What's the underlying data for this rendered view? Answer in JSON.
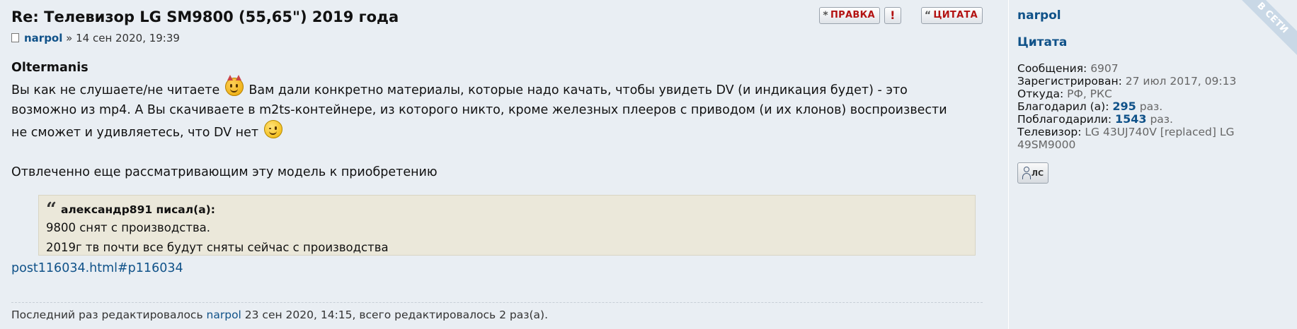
{
  "post": {
    "title": "Re: Телевизор LG SM9800 (55,65\") 2019 года",
    "author": "narpol",
    "separator": " » ",
    "date": "14 сен 2020, 19:39",
    "buttons": {
      "edit_label": "ПРАВКА",
      "report_label": "!",
      "quote_label": "ЦИТАТА"
    },
    "content": {
      "addressee": "Oltermanis",
      "para1_part1": "Вы как не слушаете/не читаете",
      "para1_part2": "Вам дали конкретно материалы, которые надо качать, чтобы увидеть DV (и индикация будет) - это",
      "para1_line2": "возможно из mp4. А Вы скачиваете в m2ts-контейнере, из которого никто, кроме железных плееров с приводом (и их клонов) воспроизвести",
      "para1_line3": "не сможет и удивляетесь, что DV нет",
      "para2": "Отвлеченно еще рассматривающим эту модель к приобретению"
    },
    "quote": {
      "author_cite": "александр891 писал(а):",
      "line1": "9800 снят с производства.",
      "line2": "2019г тв почти все будут сняты сейчас с производства"
    },
    "link": "post116034.html#p116034",
    "edit_note": {
      "prefix": "Последний раз редактировалось ",
      "user": "narpol",
      "suffix": " 23 сен 2020, 14:15, всего редактировалось 2 раз(а)."
    },
    "icons": {
      "smiley1": "evil-smiley-icon",
      "smiley2": "wink-smiley-icon"
    }
  },
  "profile": {
    "username": "narpol",
    "rank": "Цитата",
    "stats": [
      {
        "label": "Сообщения:",
        "value": "6907"
      },
      {
        "label": "Зарегистрирован:",
        "value": "27 июл 2017, 09:13"
      },
      {
        "label": "Откуда:",
        "value": "РФ, РКС"
      }
    ],
    "thanked_label": "Благодарил (а):",
    "thanked_count": "295",
    "thanked_suffix": " раз.",
    "received_label": "Поблагодарили:",
    "received_count": "1543",
    "received_suffix": " раз.",
    "tv_label": "Телевизор:",
    "tv_value": "LG 43UJ740V [replaced] LG 49SM9000",
    "pm_label": "ЛС",
    "online_badge": "В СЕТИ"
  },
  "colors": {
    "link": "#105289",
    "button_text": "#b31212",
    "quote_bg": "#ebe8da",
    "post_bg": "#e9eef3"
  }
}
